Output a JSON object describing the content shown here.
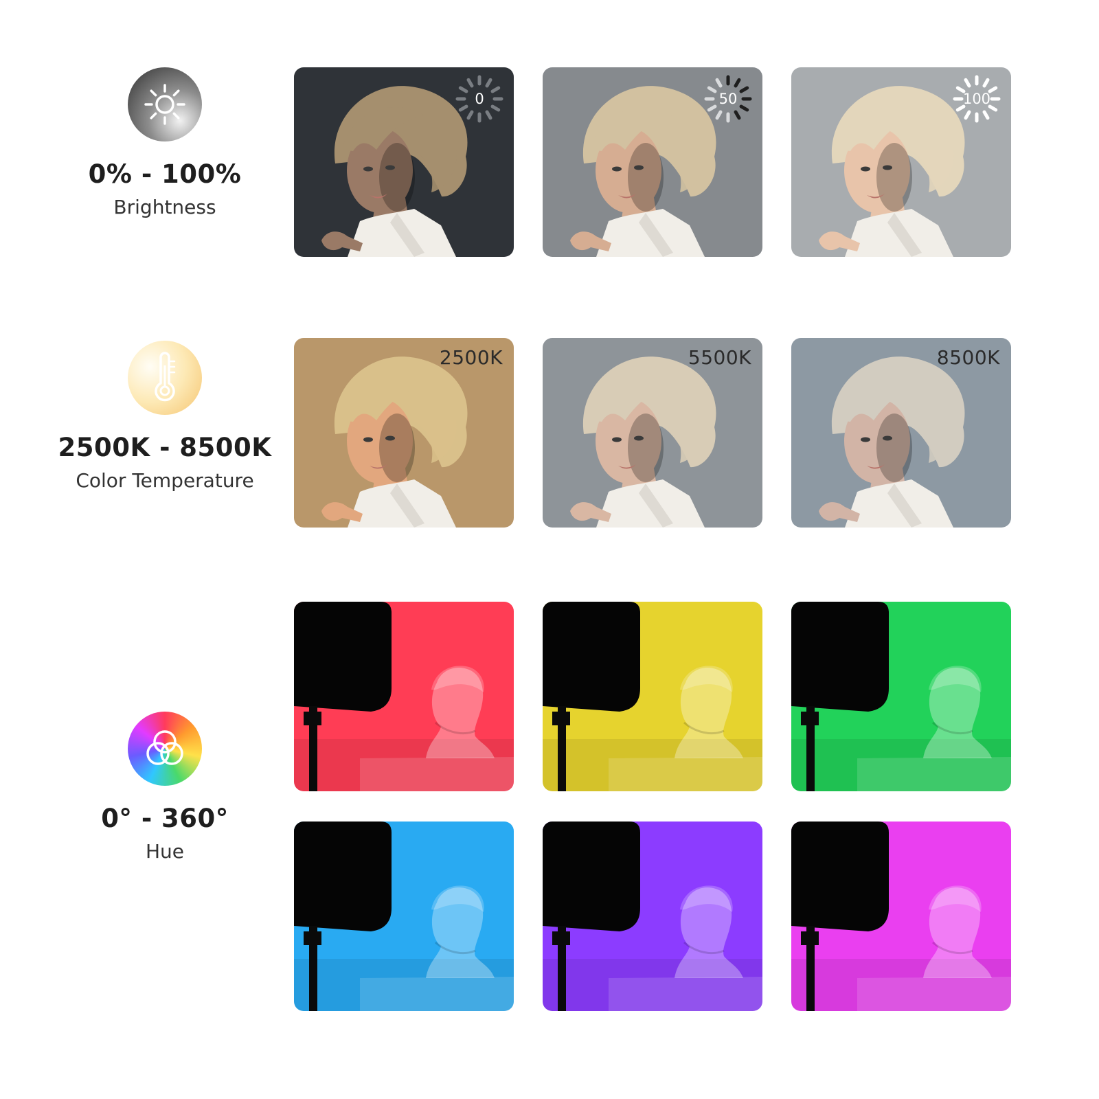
{
  "features": {
    "brightness": {
      "value": "0% - 100%",
      "label": "Brightness",
      "icon": "sun-icon"
    },
    "color_temperature": {
      "value": "2500K - 8500K",
      "label": "Color Temperature",
      "icon": "thermometer-icon"
    },
    "hue": {
      "value": "0° - 360°",
      "label": "Hue",
      "icon": "color-circles-icon"
    }
  },
  "brightness_tiles": [
    {
      "badge": "0",
      "background": "#2f3338"
    },
    {
      "badge": "50",
      "background": "#868a8e"
    },
    {
      "badge": "100",
      "background": "#a8acaf"
    }
  ],
  "temperature_tiles": [
    {
      "label": "2500K",
      "background": "#b9976a"
    },
    {
      "label": "5500K",
      "background": "#8e9499"
    },
    {
      "label": "8500K",
      "background": "#8d99a3"
    }
  ],
  "hue_tiles": [
    {
      "color": "#ff3d55"
    },
    {
      "color": "#e6d32e"
    },
    {
      "color": "#22d25a"
    },
    {
      "color": "#29aaf2"
    },
    {
      "color": "#8c3cff"
    },
    {
      "color": "#ea3ff0"
    }
  ]
}
